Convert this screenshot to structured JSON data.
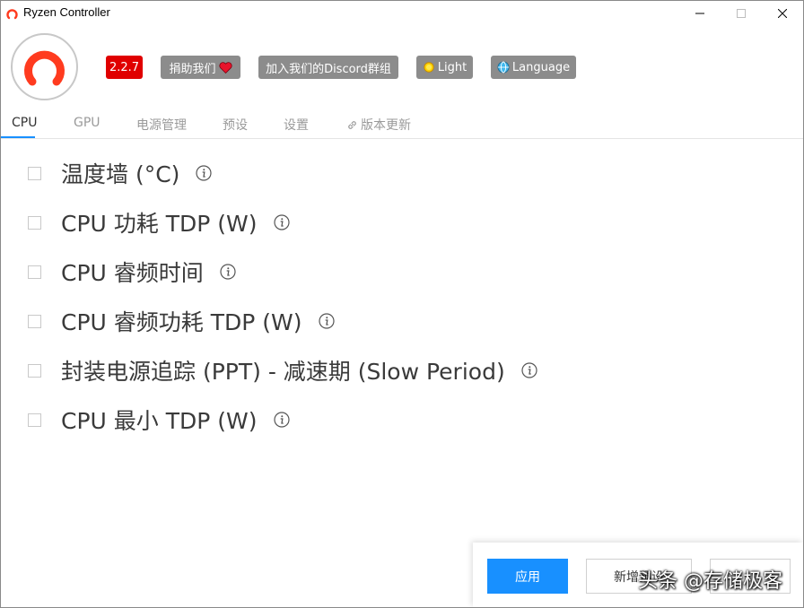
{
  "window": {
    "title": "Ryzen Controller",
    "controls": [
      "minimize-icon",
      "maximize-icon",
      "close-icon"
    ]
  },
  "header": {
    "version": "2.2.7",
    "donate_label": "捐助我们",
    "discord_label": "加入我们的Discord群组",
    "theme_label": "Light",
    "language_label": "Language",
    "colors": {
      "version_bg": "#e00000",
      "button_bg": "#8c8c8c",
      "logo_red": "#ff3b1f"
    }
  },
  "tabs": [
    {
      "label": "CPU",
      "active": true
    },
    {
      "label": "GPU",
      "active": false
    },
    {
      "label": "电源管理",
      "active": false
    },
    {
      "label": "预设",
      "active": false
    },
    {
      "label": "设置",
      "active": false
    },
    {
      "label": "版本更新",
      "active": false,
      "icon": "link-icon"
    }
  ],
  "settings": [
    {
      "label": "温度墙 (°C)",
      "checked": false
    },
    {
      "label": "CPU 功耗 TDP (W)",
      "checked": false
    },
    {
      "label": "CPU 睿频时间",
      "checked": false
    },
    {
      "label": "CPU 睿频功耗 TDP (W)",
      "checked": false
    },
    {
      "label": "封装电源追踪 (PPT) - 减速期 (Slow Period)",
      "checked": false
    },
    {
      "label": "CPU 最小 TDP (W)",
      "checked": false
    }
  ],
  "footer": {
    "apply_label": "应用",
    "new_preset_label": "新增预设",
    "third_label": "",
    "watermark": "头条 @存储极客",
    "accent": "#1890ff"
  }
}
